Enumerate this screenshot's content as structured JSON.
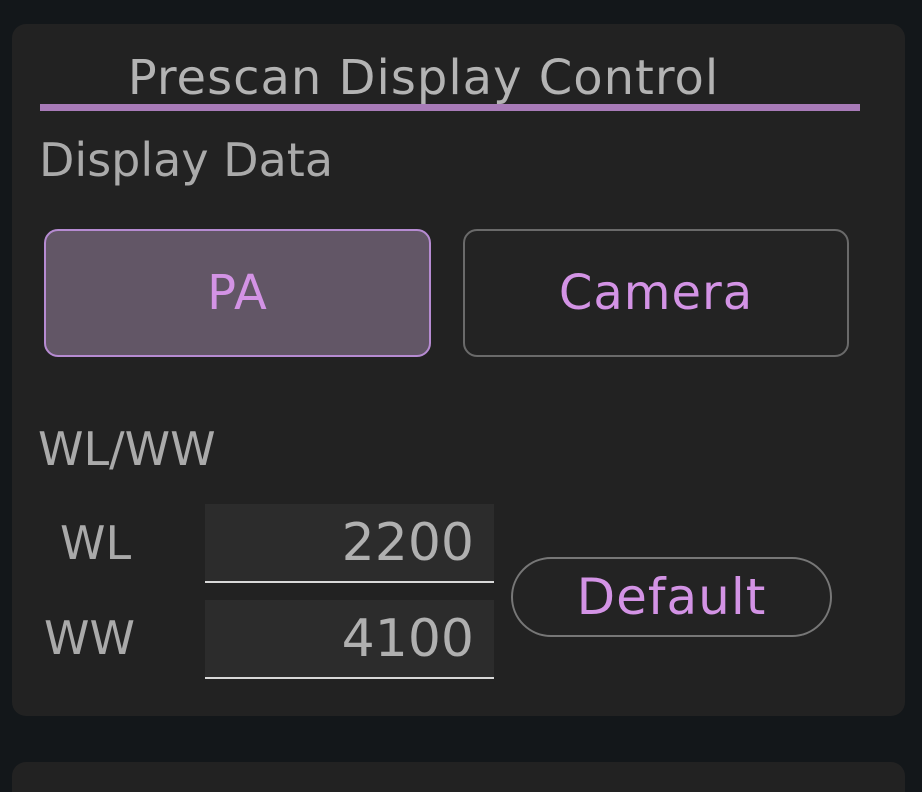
{
  "panel": {
    "title": "Prescan Display Control",
    "accent_color": "#a87bb8"
  },
  "display_data": {
    "label": "Display Data",
    "buttons": [
      {
        "label": "PA",
        "selected": true
      },
      {
        "label": "Camera",
        "selected": false
      }
    ]
  },
  "wlww": {
    "label": "WL/WW",
    "wl_label": "WL",
    "wl_value": "2200",
    "ww_label": "WW",
    "ww_value": "4100",
    "default_label": "Default"
  }
}
